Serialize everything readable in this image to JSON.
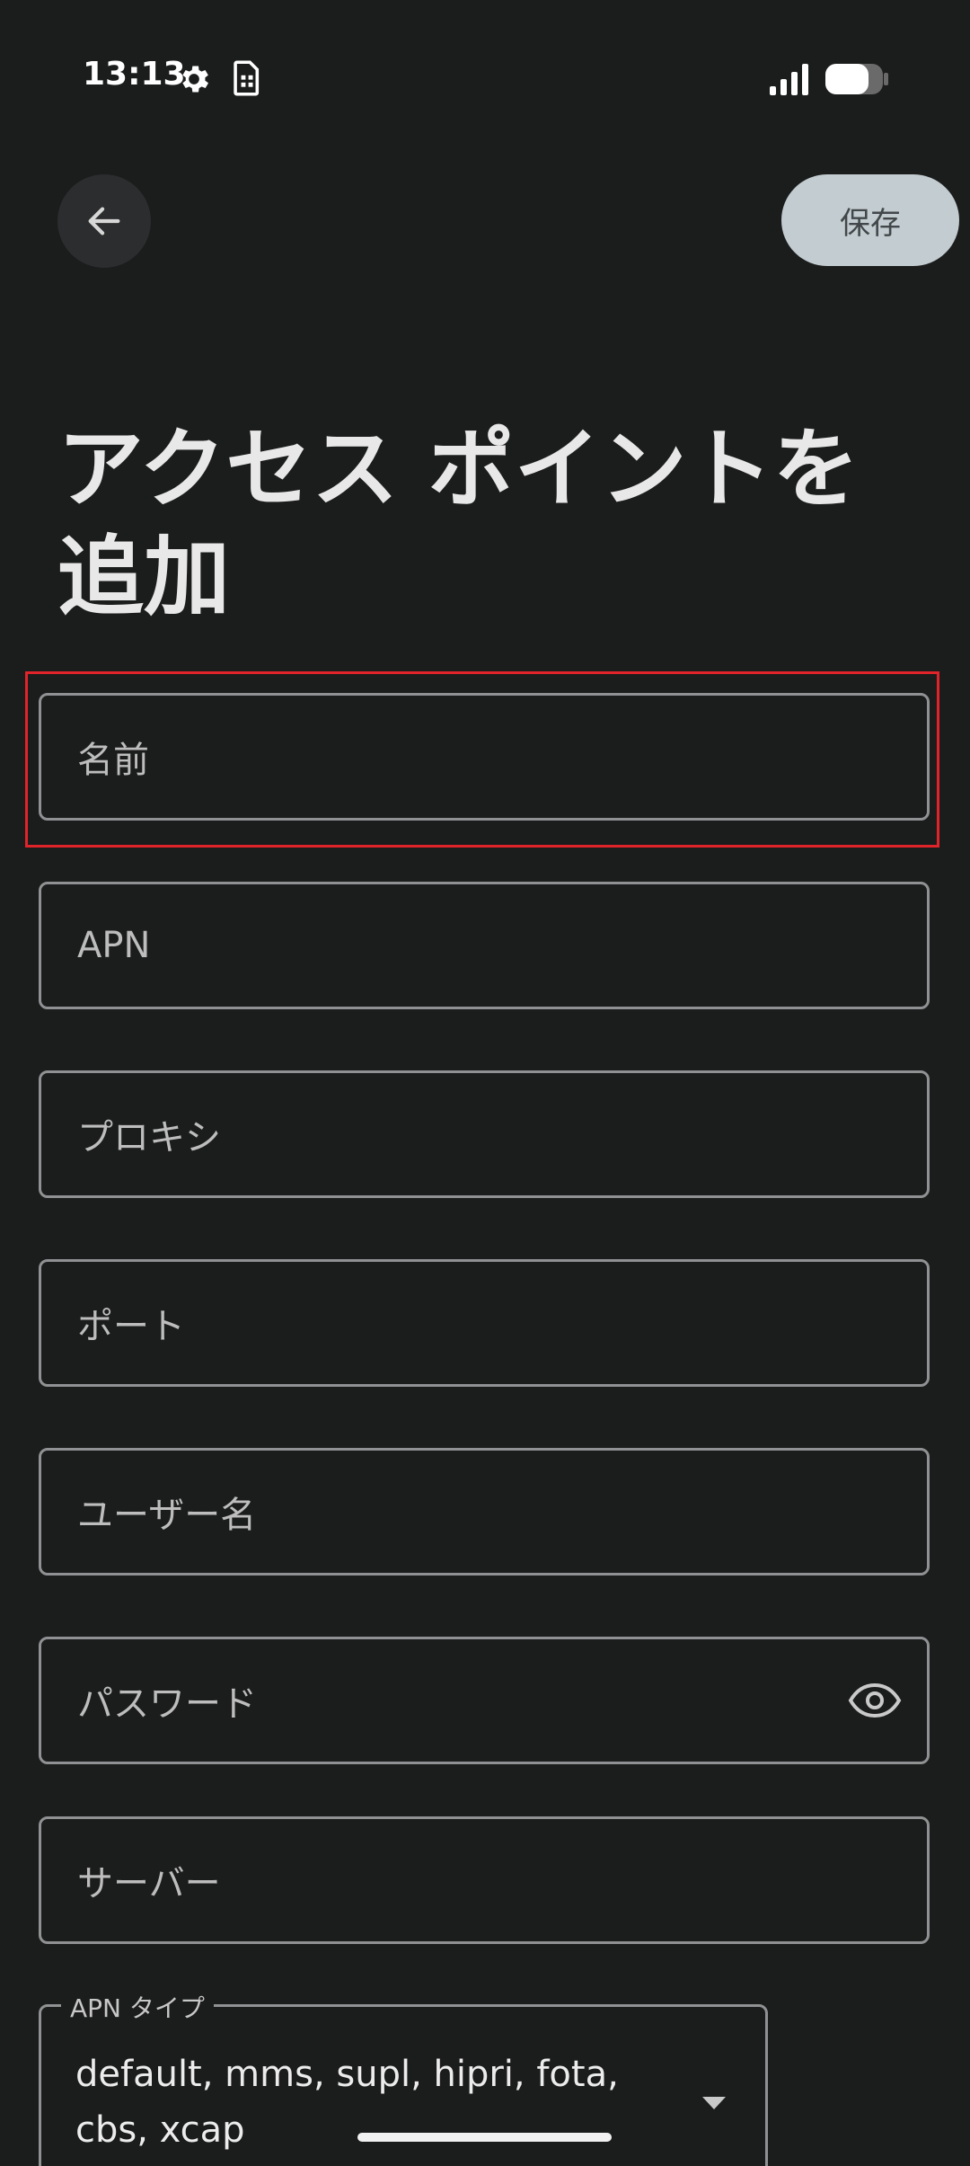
{
  "status_bar": {
    "time": "13:13",
    "icons": [
      "gear-icon",
      "sim-icon",
      "signal-icon",
      "battery-icon"
    ]
  },
  "top_bar": {
    "back_icon": "arrow-left-icon",
    "save_label": "保存"
  },
  "title": "アクセス ポイントを追加",
  "title_lines": [
    "アクセス ポイントを",
    "追加"
  ],
  "fields": [
    {
      "placeholder": "名前",
      "highlighted": true
    },
    {
      "placeholder": "APN"
    },
    {
      "placeholder": "プロキシ"
    },
    {
      "placeholder": "ポート"
    },
    {
      "placeholder": "ユーザー名"
    },
    {
      "placeholder": "パスワード",
      "icon": "eye-icon"
    },
    {
      "placeholder": "サーバー"
    }
  ],
  "apn_type": {
    "label": "APN タイプ",
    "value_lines": [
      "default, mms, supl, hipri, fota,",
      "cbs, xcap"
    ]
  },
  "colors": {
    "background": "#1b1c1c",
    "save_button": "#c3ccd0",
    "highlight": "#e1232a",
    "field_border": "#8f9192"
  }
}
